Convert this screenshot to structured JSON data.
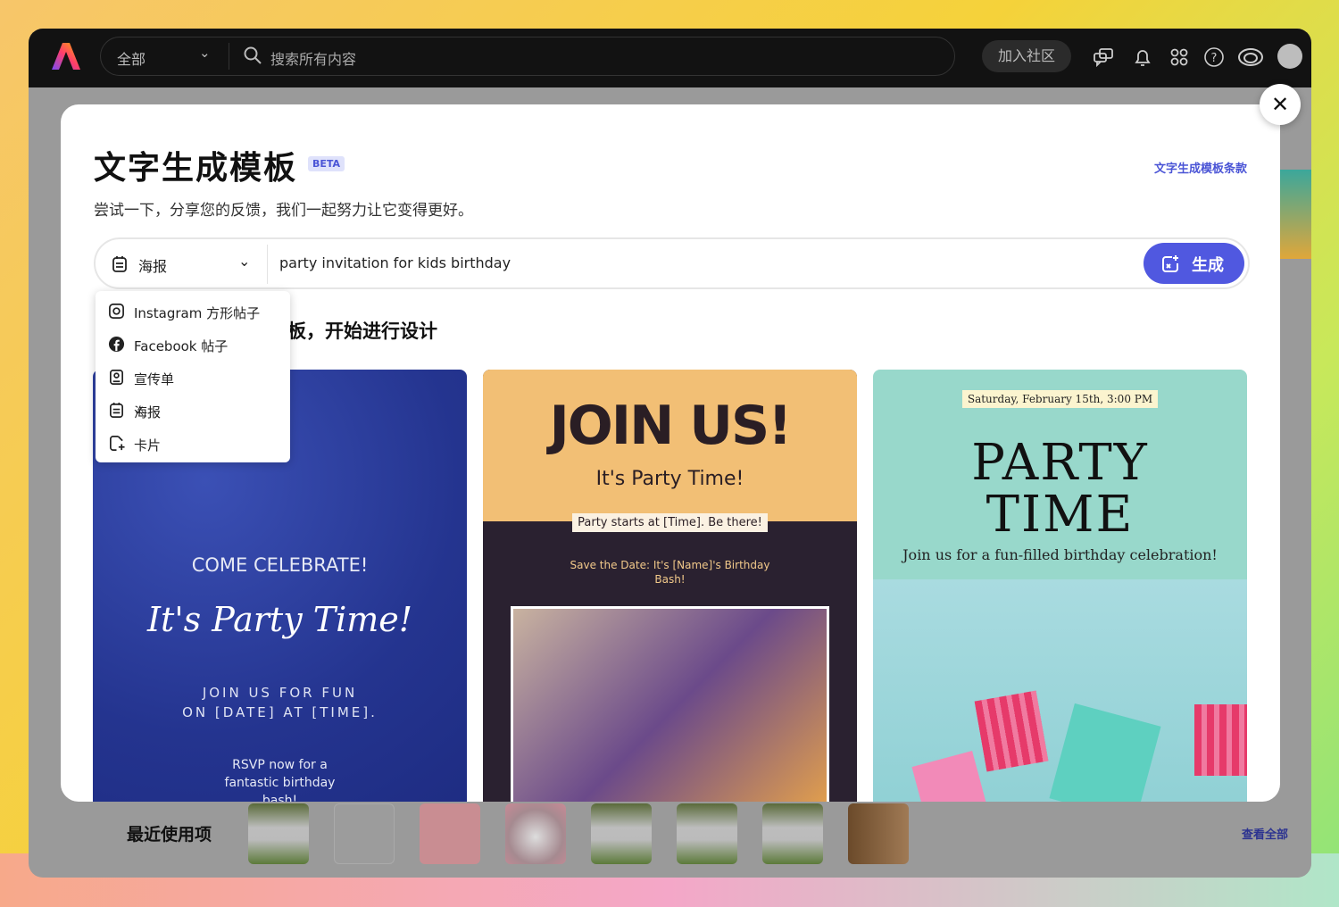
{
  "topbar": {
    "scope": "全部",
    "search_placeholder": "搜索所有内容",
    "join_label": "加入社区",
    "icons": [
      "chat-icon",
      "bell-icon",
      "apps-icon",
      "help-icon",
      "creative-cloud-icon",
      "avatar"
    ]
  },
  "modal": {
    "title": "文字生成模板",
    "beta": "BETA",
    "terms_link": "文字生成模板条款",
    "subtitle": "尝试一下，分享您的反馈，我们一起努力让它变得更好。",
    "type_selected": "海报",
    "prompt_value": "party invitation for kids birthday",
    "generate_label": "生成",
    "section_heading_visible": "板，开始进行设计",
    "type_options": [
      {
        "label": "Instagram 方形帖子",
        "icon": "instagram-icon"
      },
      {
        "label": "Facebook 帖子",
        "icon": "facebook-icon"
      },
      {
        "label": "宣传单",
        "icon": "flyer-icon"
      },
      {
        "label": "海报",
        "icon": "poster-icon",
        "selected": true
      },
      {
        "label": "卡片",
        "icon": "card-icon"
      }
    ],
    "cards": [
      {
        "l1": "COME CELEBRATE!",
        "l2": "It's Party Time!",
        "l3": "JOIN US FOR FUN",
        "l4": "ON [DATE] AT [TIME].",
        "l5": "RSVP now for a",
        "l6": "fantastic birthday",
        "l7": "bash!"
      },
      {
        "l1": "JOIN US!",
        "l2": "It's Party Time!",
        "l3": "Party starts at [Time]. Be there!",
        "l4": "Save the Date: It's [Name]'s Birthday",
        "l5": "Bash!"
      },
      {
        "l1": "Saturday, February 15th, 3:00 PM",
        "l2": "PARTY",
        "l3": "TIME",
        "l4": "Join us for a fun-filled birthday celebration!"
      }
    ]
  },
  "recent": {
    "title": "最近使用项",
    "view_all": "查看全部"
  },
  "colors": {
    "accent": "#5058e0",
    "link": "#4b55d6",
    "topbar": "#121212"
  }
}
